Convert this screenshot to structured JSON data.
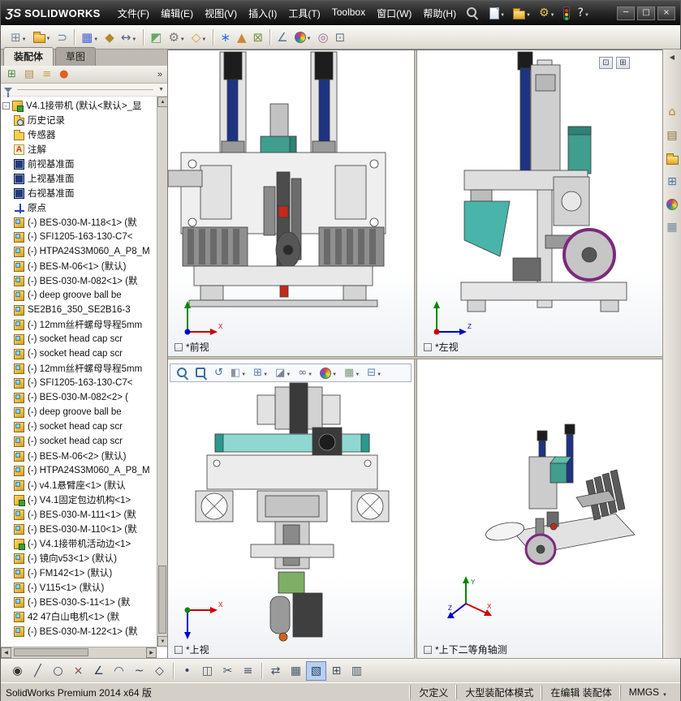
{
  "titlebar": {
    "logo_mark": "ƷS",
    "logo_text": "SOLIDWORKS",
    "menus": [
      {
        "label": "文件(F)"
      },
      {
        "label": "编辑(E)"
      },
      {
        "label": "视图(V)"
      },
      {
        "label": "插入(I)"
      },
      {
        "label": "工具(T)"
      },
      {
        "label": "Toolbox"
      },
      {
        "label": "窗口(W)"
      },
      {
        "label": "帮助(H)"
      }
    ],
    "quick_icons": [
      {
        "name": "new-document",
        "cls": "doc",
        "caret": true
      },
      {
        "name": "open-document",
        "cls": "folder",
        "caret": true
      },
      {
        "name": "options",
        "glyph": "⚙",
        "color": "#e8c84a",
        "caret": true
      },
      {
        "name": "performance-lights",
        "cls": "traffic"
      },
      {
        "name": "help",
        "glyph": "?",
        "color": "#f0f0f0",
        "caret": true
      }
    ],
    "window_buttons": [
      {
        "name": "minimize",
        "glyph": "─"
      },
      {
        "name": "maximize",
        "glyph": "□"
      },
      {
        "name": "close",
        "glyph": "×"
      }
    ]
  },
  "toolbar": {
    "icons": [
      {
        "name": "insert-components",
        "glyph": "⊞",
        "color": "#7a8ba3",
        "caret": true
      },
      {
        "name": "insert-from-file",
        "cls": "folder",
        "caret": true
      },
      {
        "name": "mate",
        "glyph": "⊃",
        "color": "#5b7fae"
      },
      {
        "name": "linear-component-pattern",
        "glyph": "▦",
        "color": "#4466cc",
        "caret": true,
        "sep": true
      },
      {
        "name": "smart-fasteners",
        "glyph": "◆",
        "color": "#b08a2a"
      },
      {
        "name": "move-component",
        "glyph": "↔",
        "color": "#556677",
        "caret": true
      },
      {
        "name": "show-hidden-components",
        "glyph": "◩",
        "color": "#66aa66",
        "sep": true
      },
      {
        "name": "assembly-features",
        "glyph": "⚙",
        "color": "#777777",
        "caret": true
      },
      {
        "name": "reference-geometry",
        "glyph": "◇",
        "color": "#caa332",
        "caret": true
      },
      {
        "name": "new-motion-study",
        "glyph": "∗",
        "color": "#3377cc",
        "sep": true
      },
      {
        "name": "exploded-view",
        "glyph": "▲",
        "color": "#cc8833"
      },
      {
        "name": "interference-detection",
        "glyph": "⊠",
        "color": "#779944"
      },
      {
        "name": "measure",
        "glyph": "∠",
        "color": "#557799",
        "sep": true
      },
      {
        "name": "appearances",
        "cls": "wheel",
        "caret": true
      },
      {
        "name": "isolate",
        "glyph": "◎",
        "color": "#996699"
      },
      {
        "name": "large-assembly-mode",
        "glyph": "⊡",
        "color": "#667788"
      }
    ]
  },
  "panel": {
    "tabs": [
      {
        "label": "装配体",
        "active": true
      },
      {
        "label": "草图"
      }
    ],
    "header_icons": [
      {
        "name": "featuremanager-tree",
        "glyph": "⊞",
        "color": "#4a8f3f"
      },
      {
        "name": "propertymanager",
        "glyph": "▤",
        "color": "#b8914a"
      },
      {
        "name": "configurationmanager",
        "glyph": "≡",
        "color": "#caa332"
      },
      {
        "name": "dimxpertmanager",
        "glyph": "●",
        "color": "#e06020"
      }
    ],
    "chevron": "»"
  },
  "tree": {
    "items": [
      {
        "label": "V4.1接带机 (默认<默认>_显",
        "icon": "assembly",
        "indent": 0,
        "exp": true
      },
      {
        "label": "历史记录",
        "icon": "history",
        "indent": 1
      },
      {
        "label": "传感器",
        "icon": "sensors",
        "indent": 1
      },
      {
        "label": "注解",
        "icon": "annotations",
        "indent": 1
      },
      {
        "label": "前视基准面",
        "icon": "plane",
        "indent": 1
      },
      {
        "label": "上视基准面",
        "icon": "plane",
        "indent": 1
      },
      {
        "label": "右视基准面",
        "icon": "plane",
        "indent": 1
      },
      {
        "label": "原点",
        "icon": "origin",
        "indent": 1
      },
      {
        "label": "(-) BES-030-M-118<1> (默",
        "icon": "component",
        "indent": 1
      },
      {
        "label": "(-) SFI1205-163-130-C7<",
        "icon": "component",
        "indent": 1
      },
      {
        "label": "(-) HTPA24S3M060_A_P8_M",
        "icon": "component",
        "indent": 1
      },
      {
        "label": "(-) BES-M-06<1> (默认)",
        "icon": "component",
        "indent": 1
      },
      {
        "label": "(-) BES-030-M-082<1> (默",
        "icon": "component",
        "indent": 1
      },
      {
        "label": "(-) deep groove ball be",
        "icon": "component",
        "indent": 1
      },
      {
        "label": "SE2B16_350_SE2B16-3",
        "icon": "component",
        "indent": 1
      },
      {
        "label": "(-) 12mm丝杆螺母导程5mm",
        "icon": "component",
        "indent": 1
      },
      {
        "label": "(-) socket head cap scr",
        "icon": "component",
        "indent": 1
      },
      {
        "label": "(-) socket head cap scr",
        "icon": "component",
        "indent": 1
      },
      {
        "label": "(-) 12mm丝杆螺母导程5mm",
        "icon": "component",
        "indent": 1
      },
      {
        "label": "(-) SFI1205-163-130-C7<",
        "icon": "component",
        "indent": 1
      },
      {
        "label": "(-) BES-030-M-082<2> (",
        "icon": "component",
        "indent": 1
      },
      {
        "label": "(-) deep groove ball be",
        "icon": "component",
        "indent": 1
      },
      {
        "label": "(-) socket head cap scr",
        "icon": "component",
        "indent": 1
      },
      {
        "label": "(-) socket head cap scr",
        "icon": "component",
        "indent": 1
      },
      {
        "label": "(-) BES-M-06<2> (默认)",
        "icon": "component",
        "indent": 1
      },
      {
        "label": "(-) HTPA24S3M060_A_P8_M",
        "icon": "component",
        "indent": 1
      },
      {
        "label": "(-) v4.1悬臂座<1> (默认",
        "icon": "component",
        "indent": 1
      },
      {
        "label": "(-) V4.1固定包边机构<1>",
        "icon": "subassembly",
        "indent": 1
      },
      {
        "label": "(-) BES-030-M-111<1> (默",
        "icon": "component",
        "indent": 1
      },
      {
        "label": "(-) BES-030-M-110<1> (默",
        "icon": "component",
        "indent": 1
      },
      {
        "label": "(-) V4.1接带机活动边<1>",
        "icon": "subassembly",
        "indent": 1
      },
      {
        "label": "(-) 镜向v53<1> (默认)",
        "icon": "component",
        "indent": 1
      },
      {
        "label": "(-) FM142<1> (默认)",
        "icon": "component",
        "indent": 1
      },
      {
        "label": "(-) V115<1> (默认)",
        "icon": "component",
        "indent": 1
      },
      {
        "label": "(-) BES-030-S-11<1> (默",
        "icon": "component",
        "indent": 1
      },
      {
        "label": "42 47白山电机<1> (默",
        "icon": "component",
        "indent": 1
      },
      {
        "label": "(-) BES-030-M-122<1> (默",
        "icon": "component",
        "indent": 1
      }
    ]
  },
  "viewports": {
    "front": {
      "label": "*前视"
    },
    "left": {
      "label": "*左视"
    },
    "top": {
      "label": "*上视"
    },
    "iso": {
      "label": "*上下二等角轴测"
    },
    "controls": [
      {
        "name": "viewport-single",
        "glyph": "⊡"
      },
      {
        "name": "viewport-four",
        "glyph": "⊞"
      }
    ]
  },
  "hud": {
    "items": [
      {
        "name": "zoom-to-fit",
        "cls": "mag"
      },
      {
        "name": "zoom-to-area",
        "cls": "mag area"
      },
      {
        "name": "previous-view",
        "glyph": "↺",
        "color": "#3a6ea5"
      },
      {
        "name": "section-view",
        "glyph": "◧",
        "color": "#8a94a8",
        "caret": true
      },
      {
        "name": "view-orientation",
        "glyph": "⊞",
        "color": "#5a7fae",
        "caret": true
      },
      {
        "name": "display-style",
        "glyph": "◪",
        "color": "#7a8598",
        "caret": true
      },
      {
        "name": "hide-show-items",
        "glyph": "∞",
        "color": "#556688",
        "caret": true
      },
      {
        "name": "edit-appearance",
        "cls": "wheel",
        "caret": true
      },
      {
        "name": "apply-scene",
        "glyph": "▦",
        "color": "#7a9a7a",
        "caret": true
      },
      {
        "name": "view-settings",
        "glyph": "⊟",
        "color": "#5a7fae",
        "caret": true
      }
    ]
  },
  "right_pane": {
    "collapse_glyph": "◀",
    "icons": [
      {
        "name": "solidworks-resources",
        "glyph": "⌂",
        "color": "#c07a2a"
      },
      {
        "name": "design-library",
        "glyph": "▤",
        "color": "#8a6f3a"
      },
      {
        "name": "file-explorer",
        "cls": "folder"
      },
      {
        "name": "view-palette",
        "glyph": "⊞",
        "color": "#4477aa"
      },
      {
        "name": "appearances-scenes",
        "cls": "wheel"
      },
      {
        "name": "custom-properties",
        "glyph": "▦",
        "color": "#778899"
      }
    ]
  },
  "bottom_toolbar": {
    "icons": [
      {
        "name": "smart-dimension",
        "glyph": "◉",
        "color": "#333333"
      },
      {
        "name": "line",
        "glyph": "╱",
        "color": "#334466"
      },
      {
        "name": "circle",
        "glyph": "○",
        "color": "#334466"
      },
      {
        "name": "erase",
        "glyph": "×",
        "color": "#884444"
      },
      {
        "name": "angle",
        "glyph": "∠",
        "color": "#334466"
      },
      {
        "name": "arc",
        "glyph": "◠",
        "color": "#334466"
      },
      {
        "name": "spline",
        "glyph": "~",
        "color": "#334466"
      },
      {
        "name": "polygon",
        "glyph": "◇",
        "color": "#334466"
      },
      {
        "name": "point",
        "glyph": "•",
        "color": "#334466",
        "sep": true
      },
      {
        "name": "mirror-entities",
        "glyph": "◫",
        "color": "#445566"
      },
      {
        "name": "trim-entities",
        "glyph": "✂",
        "color": "#445566"
      },
      {
        "name": "offset-entities",
        "glyph": "≡",
        "color": "#445566"
      },
      {
        "name": "convert-entities",
        "glyph": "⇄",
        "color": "#445566",
        "sep": true
      },
      {
        "name": "grid",
        "glyph": "▦",
        "color": "#445566"
      },
      {
        "name": "shaded-view",
        "glyph": "▧",
        "color": "#224466",
        "active": true
      },
      {
        "name": "four-view",
        "glyph": "⊞",
        "color": "#445566"
      },
      {
        "name": "table",
        "glyph": "▥",
        "color": "#445566"
      }
    ]
  },
  "statusbar": {
    "left": "SolidWorks Premium 2014 x64 版",
    "segments": [
      {
        "label": "欠定义"
      },
      {
        "label": "大型装配体模式"
      },
      {
        "label": "在编辑  装配体"
      },
      {
        "label": "MMGS",
        "caret": true
      }
    ]
  }
}
